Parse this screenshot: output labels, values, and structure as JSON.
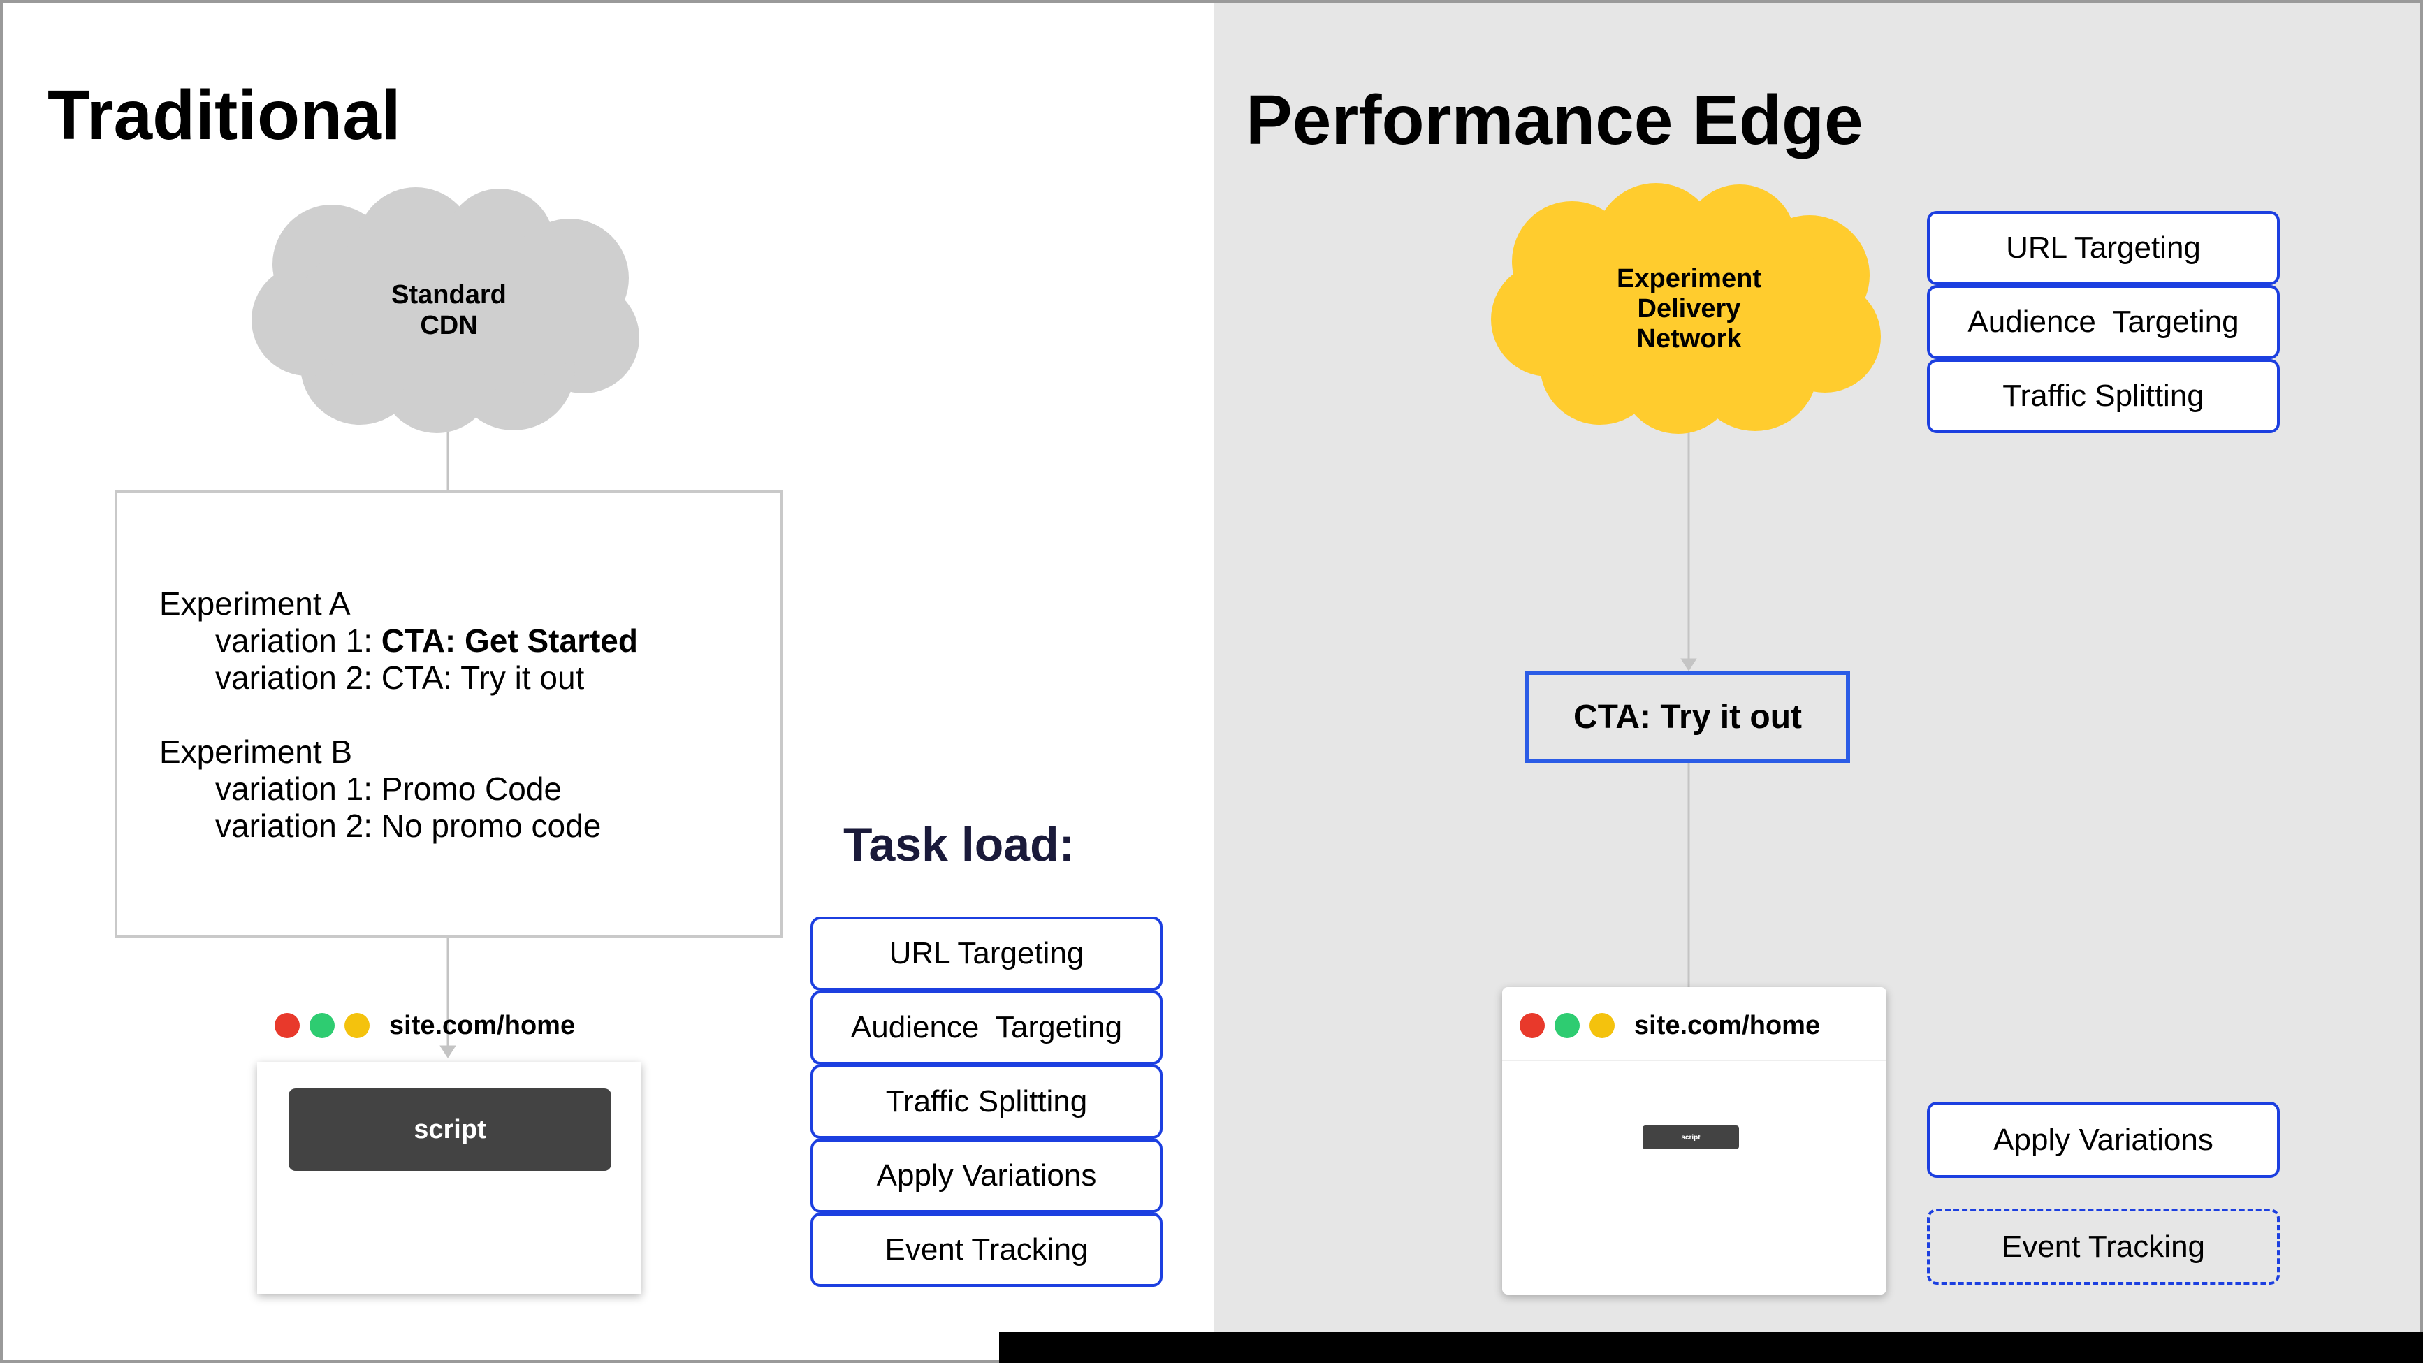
{
  "traditional": {
    "title": "Traditional",
    "cloud_label": "Standard\nCDN",
    "experiment_a": {
      "name": "Experiment A",
      "v1_prefix": "variation 1: ",
      "v1_value": "CTA: Get Started",
      "v2": "variation 2: CTA: Try it out"
    },
    "experiment_b": {
      "name": "Experiment B",
      "v1": "variation 1: Promo Code",
      "v2": "variation 2: No promo code"
    },
    "browser": {
      "url": "site.com/home",
      "script_label": "script"
    }
  },
  "task_load": {
    "title": "Task load:",
    "items": [
      "URL Targeting",
      "Audience  Targeting",
      "Traffic Splitting",
      "Apply Variations",
      "Event Tracking"
    ]
  },
  "performance_edge": {
    "title": "Performance Edge",
    "cloud_label": "Experiment\nDelivery\nNetwork",
    "edge_tasks": [
      "URL Targeting",
      "Audience  Targeting",
      "Traffic Splitting"
    ],
    "cta_label": "CTA: Try it out",
    "browser": {
      "url": "site.com/home",
      "script_label": "script"
    },
    "client_tasks": [
      "Apply Variations",
      "Event Tracking"
    ]
  },
  "colors": {
    "traffic_red": "#e8392b",
    "traffic_green": "#2ecc71",
    "traffic_yellow": "#f4c20d",
    "edge_cloud": "#ffcc2e",
    "standard_cloud": "#cfcfcf",
    "pill_border": "#1c3fe0"
  }
}
